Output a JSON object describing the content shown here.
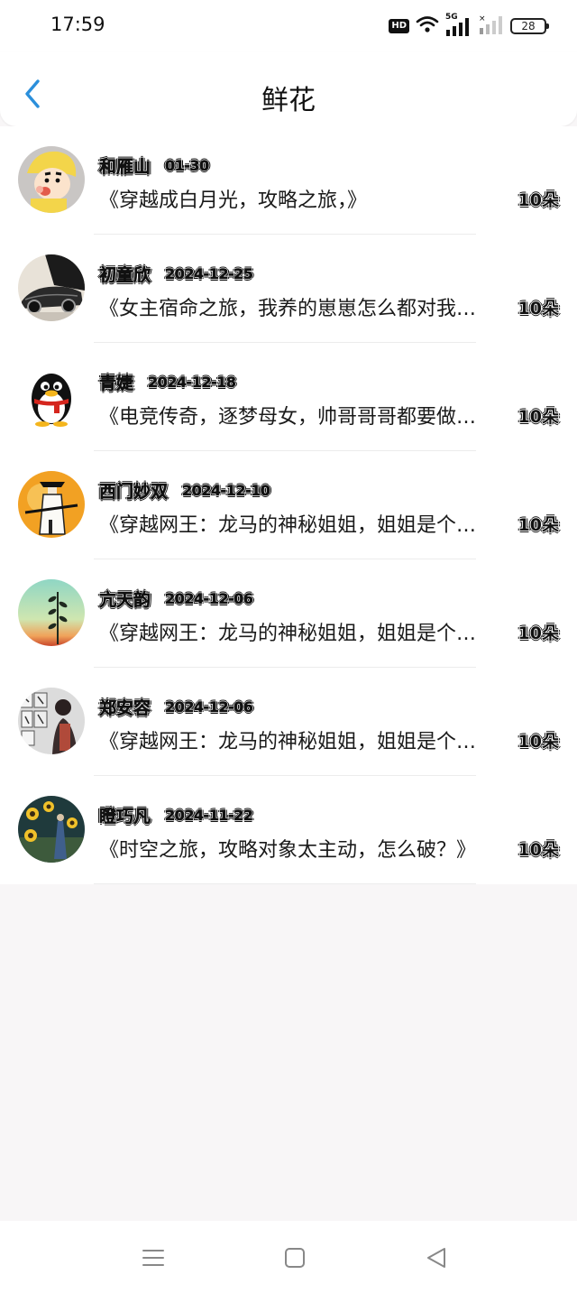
{
  "status_bar": {
    "time": "17:59",
    "hd_label": "HD",
    "signal_label": "5G",
    "battery": "28"
  },
  "header": {
    "title": "鲜花",
    "back_icon": "chevron-left-icon",
    "accent_color": "#2b8fdb"
  },
  "items": [
    {
      "name": "和雁山",
      "date": "01-30",
      "book": "《穿越成白月光，攻略之旅，》",
      "count": "10朵",
      "avatar": "cartoon-boy-avatar"
    },
    {
      "name": "初童欣",
      "date": "2024-12-25",
      "book": "《女主宿命之旅，我养的崽崽怎么都对我…",
      "count": "10朵",
      "avatar": "car-avatar"
    },
    {
      "name": "青婕",
      "date": "2024-12-18",
      "book": "《电竞传奇，逐梦母女，帅哥哥哥都要做…",
      "count": "10朵",
      "avatar": "penguin-avatar"
    },
    {
      "name": "西门妙双",
      "date": "2024-12-10",
      "book": "《穿越网王：龙马的神秘姐姐，姐姐是个…",
      "count": "10朵",
      "avatar": "swordsman-avatar"
    },
    {
      "name": "亢天韵",
      "date": "2024-12-06",
      "book": "《穿越网王：龙马的神秘姐姐，姐姐是个…",
      "count": "10朵",
      "avatar": "plant-sunset-avatar"
    },
    {
      "name": "郑安容",
      "date": "2024-12-06",
      "book": "《穿越网王：龙马的神秘姐姐，姐姐是个…",
      "count": "10朵",
      "avatar": "sketch-wall-avatar"
    },
    {
      "name": "瞪巧凡",
      "date": "2024-11-22",
      "book": "《时空之旅，攻略对象太主动，怎么破？》",
      "count": "10朵",
      "avatar": "sunflower-avatar"
    }
  ],
  "system_nav": {
    "menu_icon": "menu-icon",
    "home_icon": "home-square-icon",
    "back_icon": "back-triangle-icon"
  }
}
